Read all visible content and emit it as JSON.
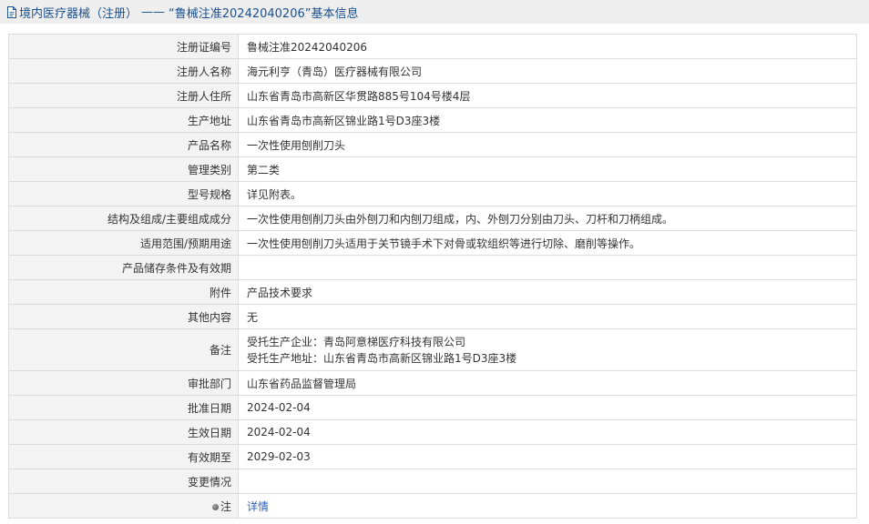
{
  "header": {
    "category": "境内医疗器械（注册）",
    "separator": "——",
    "record_title": "“鲁械注准20242040206”基本信息"
  },
  "rows": [
    {
      "label": "注册证编号",
      "value": "鲁械注准20242040206"
    },
    {
      "label": "注册人名称",
      "value": "海元利亨（青岛）医疗器械有限公司"
    },
    {
      "label": "注册人住所",
      "value": "山东省青岛市高新区华贯路885号104号楼4层"
    },
    {
      "label": "生产地址",
      "value": "山东省青岛市高新区锦业路1号D3座3楼"
    },
    {
      "label": "产品名称",
      "value": "一次性使用刨削刀头"
    },
    {
      "label": "管理类别",
      "value": "第二类"
    },
    {
      "label": "型号规格",
      "value": "详见附表。"
    },
    {
      "label": "结构及组成/主要组成成分",
      "value": "一次性使用刨削刀头由外刨刀和内刨刀组成，内、外刨刀分别由刀头、刀杆和刀柄组成。"
    },
    {
      "label": "适用范围/预期用途",
      "value": "一次性使用刨削刀头适用于关节镜手术下对骨或软组织等进行切除、磨削等操作。"
    },
    {
      "label": "产品储存条件及有效期",
      "value": ""
    },
    {
      "label": "附件",
      "value": "产品技术要求"
    },
    {
      "label": "其他内容",
      "value": "无"
    },
    {
      "label": "备注",
      "value_lines": [
        "受托生产企业：青岛阿意梯医疗科技有限公司",
        "受托生产地址：山东省青岛市高新区锦业路1号D3座3楼"
      ]
    },
    {
      "label": "审批部门",
      "value": "山东省药品监督管理局"
    },
    {
      "label": "批准日期",
      "value": "2024-02-04"
    },
    {
      "label": "生效日期",
      "value": "2024-02-04"
    },
    {
      "label": "有效期至",
      "value": "2029-02-03"
    },
    {
      "label": "变更情况",
      "value": ""
    }
  ],
  "note_row": {
    "label": "注",
    "link_text": "详情"
  },
  "colors": {
    "title_text": "#1b4f8c",
    "link": "#2a63b8",
    "label_bg": "#f3f3f3",
    "border": "#dcdcdc"
  }
}
